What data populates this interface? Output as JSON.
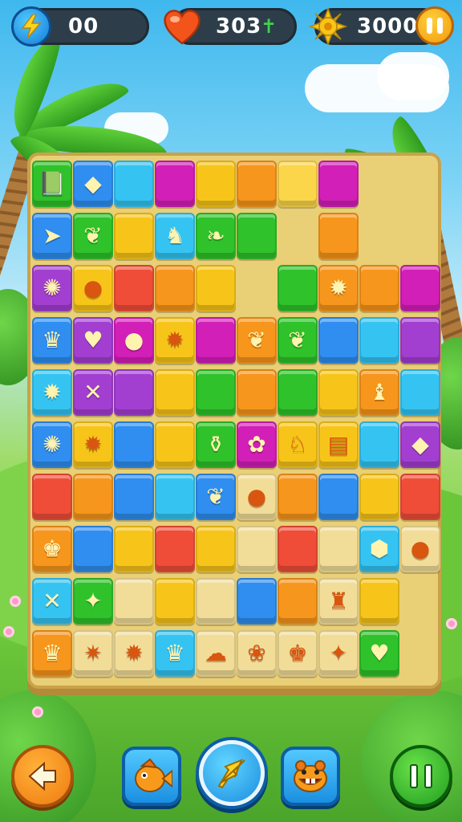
{
  "hud": {
    "energy": {
      "value": "00",
      "icon": "lightning-icon"
    },
    "lives": {
      "value": "303",
      "suffix": "✝",
      "icon": "heart-icon"
    },
    "score": {
      "value": "3000",
      "icon": "sun-icon"
    },
    "pause_icon": "pause-icon"
  },
  "colors": {
    "green": "#2fc22a",
    "blue": "#2f8ef0",
    "cyan": "#35c4f2",
    "magenta": "#d21fb7",
    "yellow": "#f7c51a",
    "orange": "#f7961c",
    "red": "#ef4d38",
    "purple": "#a23fd1",
    "lime": "#4ed62a",
    "gold": "#fbd64a",
    "pale": "#f2dd98"
  },
  "board": {
    "rows": [
      [
        "green:book",
        "blue:gem",
        "cyan:",
        "magenta:",
        "yellow:",
        "orange:",
        "gold:",
        "magenta:"
      ],
      [
        "blue:fish",
        "green:feather",
        "yellow:",
        "cyan:bird",
        "green:leaf",
        "green:",
        "",
        "orange:"
      ],
      [
        "purple:urchin",
        "yellow:frog",
        "red:",
        "orange:",
        "yellow:",
        "",
        "green:",
        "orange:sun",
        "orange:",
        "magenta:"
      ],
      [
        "blue:cat",
        "purple:heart",
        "magenta:puffer",
        "yellow:sun",
        "magenta:",
        "orange:feather",
        "green:feather",
        "blue:",
        "cyan:",
        "purple:"
      ],
      [
        "cyan:sun",
        "purple:x",
        "purple:",
        "yellow:",
        "green:",
        "orange:",
        "green:",
        "yellow:",
        "orange:dog",
        "cyan:"
      ],
      [
        "blue:urchin",
        "yellow:sun",
        "blue:",
        "yellow:",
        "green:bottle",
        "magenta:blob",
        "yellow:bunny",
        "yellow:note",
        "cyan:",
        "purple:gem"
      ],
      [
        "red:",
        "orange:",
        "blue:",
        "cyan:",
        "blue:feather",
        "pale:puffer",
        "orange:",
        "blue:",
        "yellow:",
        "red:"
      ],
      [
        "orange:fox",
        "blue:",
        "yellow:",
        "red:",
        "yellow:",
        "pale:",
        "red:",
        "pale:",
        "cyan:shoe",
        "pale:snail"
      ],
      [
        "cyan:x",
        "green:star",
        "pale:",
        "yellow:",
        "pale:",
        "blue:",
        "orange:",
        "pale:koala",
        "yellow:",
        ""
      ],
      [
        "orange:cat",
        "pale:crab",
        "pale:sun",
        "cyan:cat",
        "pale:elephant",
        "pale:flower",
        "pale:fox",
        "pale:star",
        "green:heart",
        ""
      ]
    ],
    "glyphs": {
      "book": "📗",
      "gem": "◆",
      "fish": "➤",
      "feather": "❦",
      "bird": "♞",
      "leaf": "❧",
      "urchin": "✺",
      "frog": "●",
      "sun": "✹",
      "cat": "♛",
      "heart": "♥",
      "puffer": "●",
      "x": "✕",
      "dog": "♝",
      "bottle": "⚱",
      "blob": "✿",
      "bunny": "♘",
      "note": "▤",
      "fox": "♚",
      "shoe": "⬢",
      "snail": "●",
      "star": "✦",
      "koala": "♜",
      "crab": "✷",
      "elephant": "☁",
      "flower": "❀"
    }
  },
  "controls": {
    "back_icon": "back-arrow-icon",
    "fish_icon": "fish-powerup-icon",
    "swap_icon": "arrow-swap-icon",
    "beaver_icon": "beaver-powerup-icon",
    "pause_icon": "pause-icon"
  }
}
